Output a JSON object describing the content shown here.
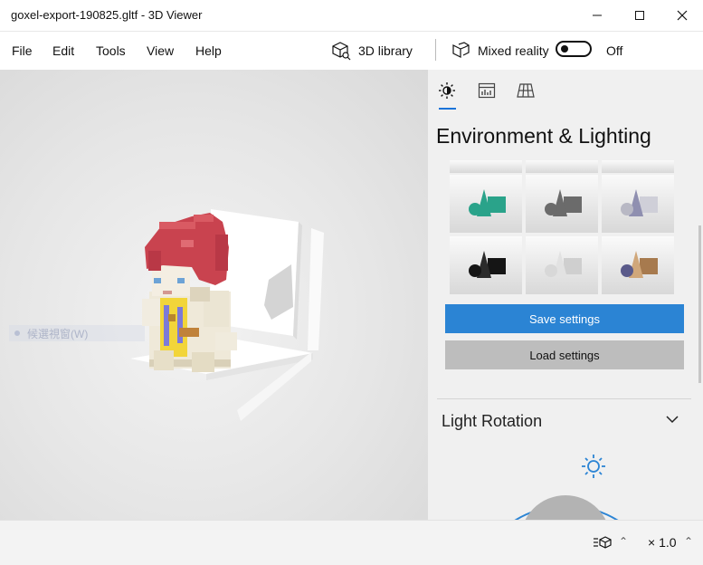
{
  "window": {
    "title": "goxel-export-190825.gltf - 3D Viewer",
    "controls": {
      "minimize": "minimize-icon",
      "maximize": "maximize-icon",
      "close": "close-icon"
    }
  },
  "menu": {
    "items": [
      {
        "label": "File"
      },
      {
        "label": "Edit"
      },
      {
        "label": "Tools"
      },
      {
        "label": "View"
      },
      {
        "label": "Help"
      }
    ],
    "library_label": "3D library",
    "mixed_reality_label": "Mixed reality",
    "toggle_state": "Off"
  },
  "viewport": {
    "ime_hint": "候選視窗(W)",
    "model": "voxel character with red hair, yellow tunic"
  },
  "panel": {
    "tabs": [
      {
        "name": "environment",
        "icon": "sun-icon",
        "selected": true
      },
      {
        "name": "stats",
        "icon": "stats-grid-icon",
        "selected": false
      },
      {
        "name": "mesh",
        "icon": "mesh-grid-icon",
        "selected": false
      }
    ],
    "heading": "Environment & Lighting",
    "swatches": [
      {
        "name": "teal",
        "color": "#2aa38a"
      },
      {
        "name": "gray",
        "color": "#6b6b6b"
      },
      {
        "name": "lavender",
        "color": "#8f8fb0"
      },
      {
        "name": "black",
        "color": "#151515"
      },
      {
        "name": "white",
        "color": "#cfcfcf"
      },
      {
        "name": "bronze",
        "color": "#a77a4e"
      }
    ],
    "save_label": "Save settings",
    "load_label": "Load settings",
    "light_rotation_label": "Light Rotation",
    "accent": "#2b84d4"
  },
  "status": {
    "zoom": "× 1.0"
  }
}
